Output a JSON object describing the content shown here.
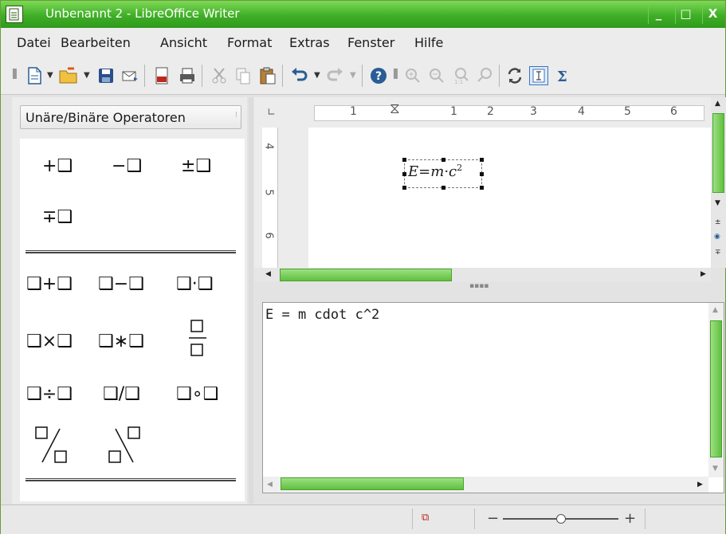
{
  "window": {
    "title": "Unbenannt 2 - LibreOffice Writer",
    "minimize": "_",
    "maximize": "□",
    "close": "X"
  },
  "menu": [
    "Datei",
    "Bearbeiten",
    "Ansicht",
    "Format",
    "Extras",
    "Fenster",
    "Hilfe"
  ],
  "toolbar": {
    "icons": [
      "new-document-icon",
      "open-icon",
      "save-icon",
      "email-icon",
      "export-pdf-icon",
      "print-icon",
      "cut-icon",
      "copy-icon",
      "paste-icon",
      "undo-icon",
      "redo-icon",
      "help-icon",
      "zoom-in-icon",
      "zoom-out-icon",
      "zoom-100-icon",
      "show-all-icon",
      "update-icon",
      "formula-cursor-icon",
      "sigma-icon"
    ]
  },
  "panel": {
    "category": "Unäre/Binäre Operatoren",
    "unary": [
      "+❑",
      "−❑",
      "±❑",
      "∓❑"
    ],
    "binary": [
      "❑+❑",
      "❑−❑",
      "❑·❑",
      "❑×❑",
      "❑∗❑",
      "❑÷❑",
      "❑/❑",
      "❑∘❑"
    ]
  },
  "ruler": {
    "horizontal": [
      "1",
      "1",
      "2",
      "3",
      "4",
      "5",
      "6"
    ],
    "vertical": [
      "4",
      "5",
      "6"
    ]
  },
  "formula": {
    "lhs": "E",
    "eq": "=",
    "m": "m",
    "dot": "·",
    "c": "c",
    "exp": "2"
  },
  "editor": {
    "text": "E = m cdot c^2"
  },
  "status": {
    "zoom_minus": "−",
    "zoom_plus": "+",
    "zoom_level": 0.5
  },
  "colors": {
    "accent": "#3fae26",
    "scroll_thumb": "#6fca4d"
  }
}
